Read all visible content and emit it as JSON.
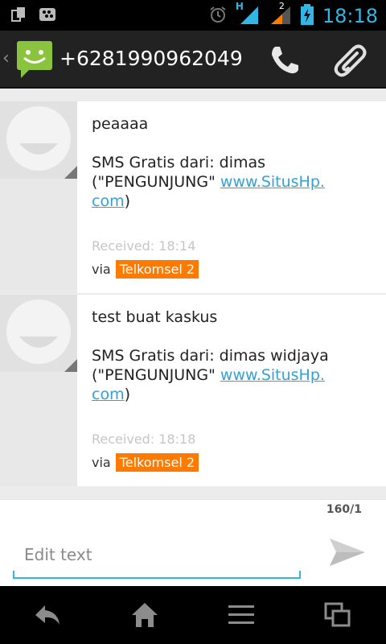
{
  "status_bar": {
    "time": "18:18",
    "network_type": "H",
    "sim2_label": "2"
  },
  "header": {
    "contact_number": "+6281990962049",
    "back_icon": "chevron-left-icon",
    "app_icon": "messaging-smiley-icon",
    "call_icon": "phone-icon",
    "attach_icon": "paperclip-icon"
  },
  "messages": [
    {
      "text_line1": "peaaaa",
      "text_line2": "SMS Gratis dari: dimas",
      "text_line3_prefix": "(\"PENGUNJUNG\" ",
      "link_part1": "www.SitusHp.",
      "link_part2": "com",
      "text_suffix": ")",
      "received": "Received: 18:14",
      "via": "via",
      "carrier": "Telkomsel 2"
    },
    {
      "text_line1": "test buat kaskus",
      "text_line2": "SMS Gratis dari: dimas widjaya",
      "text_line3_prefix": "(\"PENGUNJUNG\" ",
      "link_part1": "www.SitusHp.",
      "link_part2": "com",
      "text_suffix": ")",
      "received": "Received: 18:18",
      "via": "via",
      "carrier": "Telkomsel 2"
    }
  ],
  "compose": {
    "char_count": "160/1",
    "placeholder": "Edit text",
    "send_icon": "send-icon"
  },
  "nav": {
    "back_icon": "back-icon",
    "home_icon": "home-icon",
    "menu_icon": "menu-icon",
    "recent_icon": "recent-apps-icon"
  },
  "colors": {
    "accent": "#33b5e5",
    "carrier_badge": "#ff7a00",
    "app_icon_green": "#8ac43f"
  }
}
